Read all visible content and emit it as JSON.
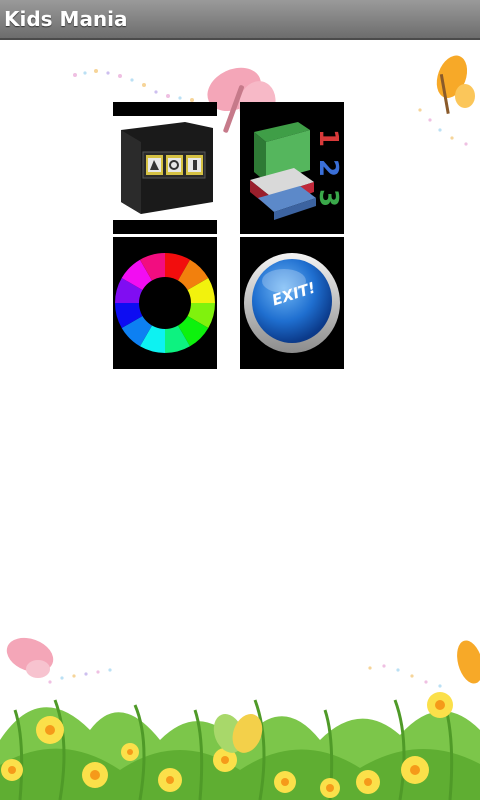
{
  "app": {
    "title": "Kids Mania"
  },
  "menu": [
    {
      "id": "album",
      "icon": "photo-album-icon"
    },
    {
      "id": "numbers",
      "icon": "numbers-books-icon",
      "digits": [
        "1",
        "2",
        "3"
      ]
    },
    {
      "id": "colors",
      "icon": "color-wheel-icon"
    },
    {
      "id": "exit",
      "icon": "exit-button-icon",
      "label": "EXIT!"
    }
  ],
  "colors": {
    "titlebar": "#7d7d7d",
    "background": "#ffffff",
    "tile_background": "#000000"
  }
}
